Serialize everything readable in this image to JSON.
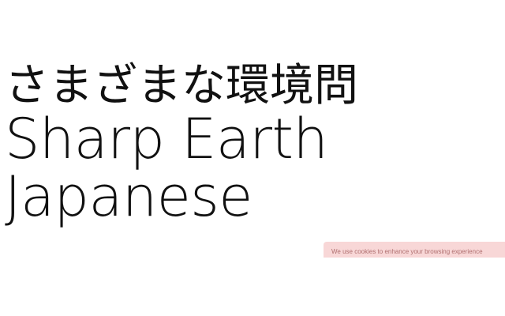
{
  "hero": {
    "line1": "さまざまな環境問",
    "line2": "Sharp Earth",
    "line3": "Japanese"
  },
  "cookie_banner": {
    "text": "We use cookies to enhance your browsing experience"
  },
  "colors": {
    "background": "#ffffff",
    "text": "#111111",
    "banner_background": "#f8d7d7",
    "banner_text": "#b07070"
  }
}
